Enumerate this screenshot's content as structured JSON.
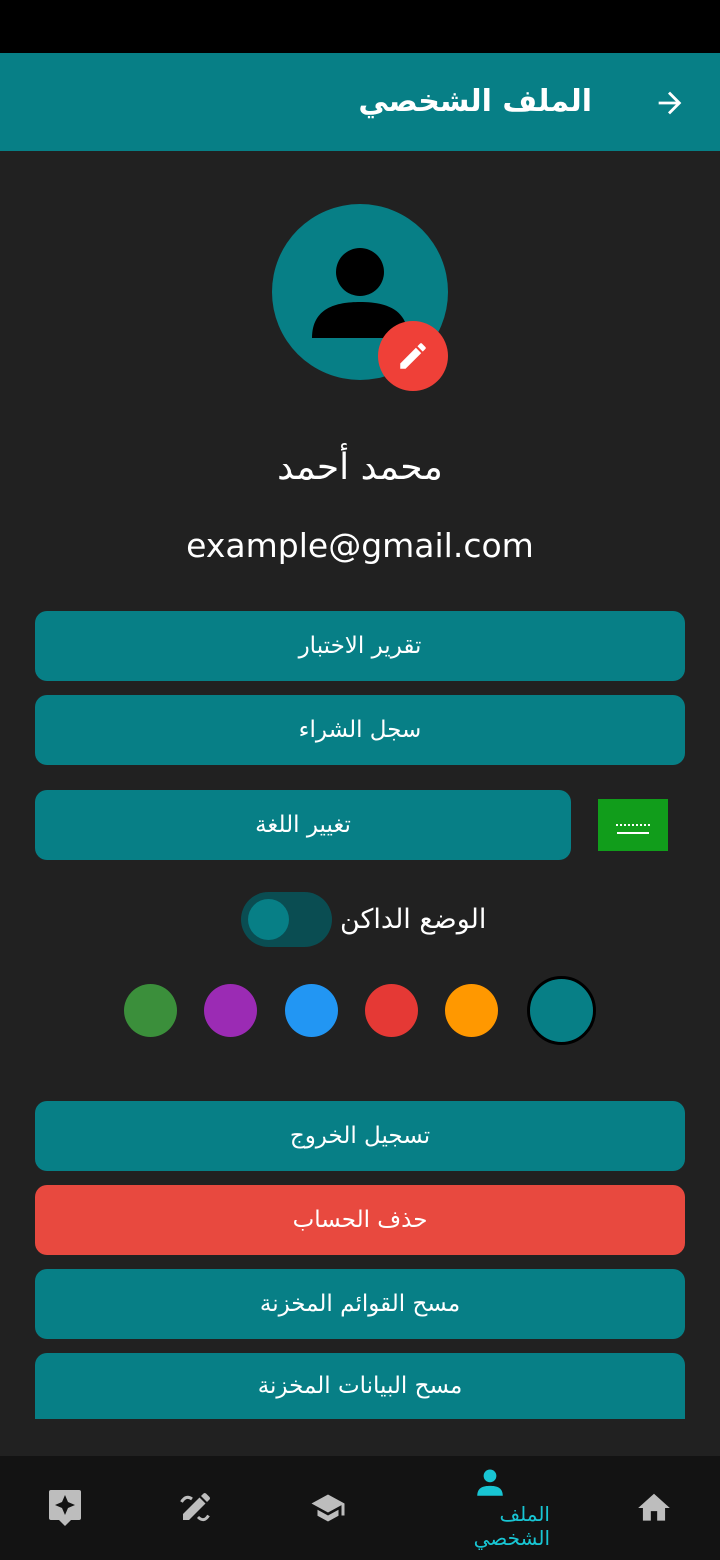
{
  "app_bar": {
    "title": "الملف الشخصي",
    "back_icon": "arrow-right-icon"
  },
  "profile": {
    "name": "محمد أحمد",
    "email": "example@gmail.com",
    "avatar_icon": "person-icon",
    "edit_icon": "pencil-icon"
  },
  "buttons": {
    "test_report": "تقرير الاختبار",
    "purchase_history": "سجل الشراء",
    "change_language": "تغيير اللغة",
    "logout": "تسجيل الخروج",
    "delete_account": "حذف الحساب",
    "clear_lists": "مسح القوائم المخزنة",
    "clear_data": "مسح البيانات المخزنة"
  },
  "dark_mode": {
    "label": "الوضع الداكن",
    "enabled": true
  },
  "theme_colors": [
    "#3b8f3b",
    "#9b2bb4",
    "#2296f3",
    "#e53935",
    "#ff9800",
    "#077f86"
  ],
  "selected_color": "#077f86",
  "colors": {
    "primary": "#077f86",
    "danger": "#e8493f",
    "background": "#212121",
    "nav_active": "#18c5d3"
  },
  "bottom_nav": {
    "profile_label": "الملف الشخصي",
    "icons": [
      "sparkle-badge-icon",
      "pencil-ruler-icon",
      "graduation-cap-icon",
      "person-icon",
      "home-icon"
    ]
  }
}
